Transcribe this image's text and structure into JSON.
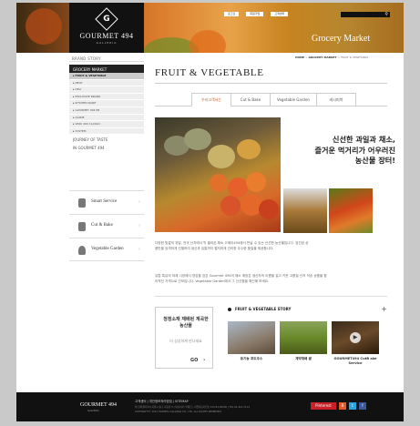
{
  "header": {
    "logo_name": "GOURMET 494",
    "logo_sub": "GALLERIA",
    "logo_letter": "G",
    "top_links": [
      "로그인",
      "회원가입",
      "고객센터"
    ],
    "section_title": "Grocery Market"
  },
  "sidebar": {
    "brand_story": "BRAND STORY",
    "grocery_market": "GROCERY MARKET",
    "sub_items": [
      "▸ FRUIT & VEGETABLE",
      "▸ MEAT",
      "▸ DELI",
      "▸ EXCLUSIVE BRAND",
      "▸ KITCHEN WARE",
      "▸ GOURMET 494 PB",
      "▸ DAIRIE",
      "▸ VINO 494 CLASSIC",
      "▸ SYSTEM"
    ],
    "journey": "JOURNEY OF TASTE",
    "in_gourmet": "IN GOURMET 494",
    "services": [
      {
        "label": "Smart Service"
      },
      {
        "label": "Cut & Bake"
      },
      {
        "label": "Vegetable Garden"
      }
    ]
  },
  "breadcrumb": {
    "home": "HOME",
    "sep1": " > ",
    "market": "GROCERY MARKET",
    "sep2": " > ",
    "current": "FRUIT & VEGETABLE"
  },
  "main": {
    "title": "FRUIT & VEGETABLE",
    "tabs": [
      "우리고객서는",
      "Cut & Bake",
      "Vegetable Garden",
      "레시피북"
    ],
    "hero_line1": "신선한 과일과 채소,",
    "hero_line2": "즐거운 먹거리가 어우러진",
    "hero_line3": "농산물 장터!",
    "desc1": "다양한 빛깔의 과일, 전국 산지에서 막 올라온 채소 고메이494에서 만날 수 있는 신선한 농산물입니다. 엄선된 상품만을 엄격하게 선별하여 생산과 유통까지 철저하게 관리한 우수한 품질을 제공합니다.",
    "desc2": "유럽 특유의 야채 시장에서 영감을 얻은 Gourmet 494의 채소 매장은 생산자의 이름을 걸고 키운 고품질 산지 직송 상품을 합리적인 가격으로 선보입니다. Vegetable Garden에서 그 신선함을 확인해 보세요.",
    "promo_title": "청정소재 재배된 계곡한 농산물",
    "promo_sub": "더 싱싱하게 만나세요",
    "promo_go": "GO",
    "story_title": "FRUIT & VEGETABLE STORY",
    "stories": [
      {
        "caption": "유기농 포도주스"
      },
      {
        "caption": "계약재배 쌀"
      },
      {
        "caption": "GOURMET494 CutB ake Service"
      }
    ]
  },
  "footer": {
    "logo": "GOURMET 494",
    "logo_sub": "GALLERIA",
    "links": "고객센터 | 개인정보처리방침 | SITEMAP",
    "address": "㈜ 한화갤러리아 서울시 중구 다동길 3 | 대표이사: 박세훈 | 사업자등록번호 123-81-00000 | TEL 02-410-7114",
    "copyright": "COPYRIGHT© 2012 HANWHA GALLERIA CO., LTD. ALL RIGHTS RESERVED.",
    "social": [
      "Pinterest",
      "B",
      "t",
      "f"
    ]
  }
}
